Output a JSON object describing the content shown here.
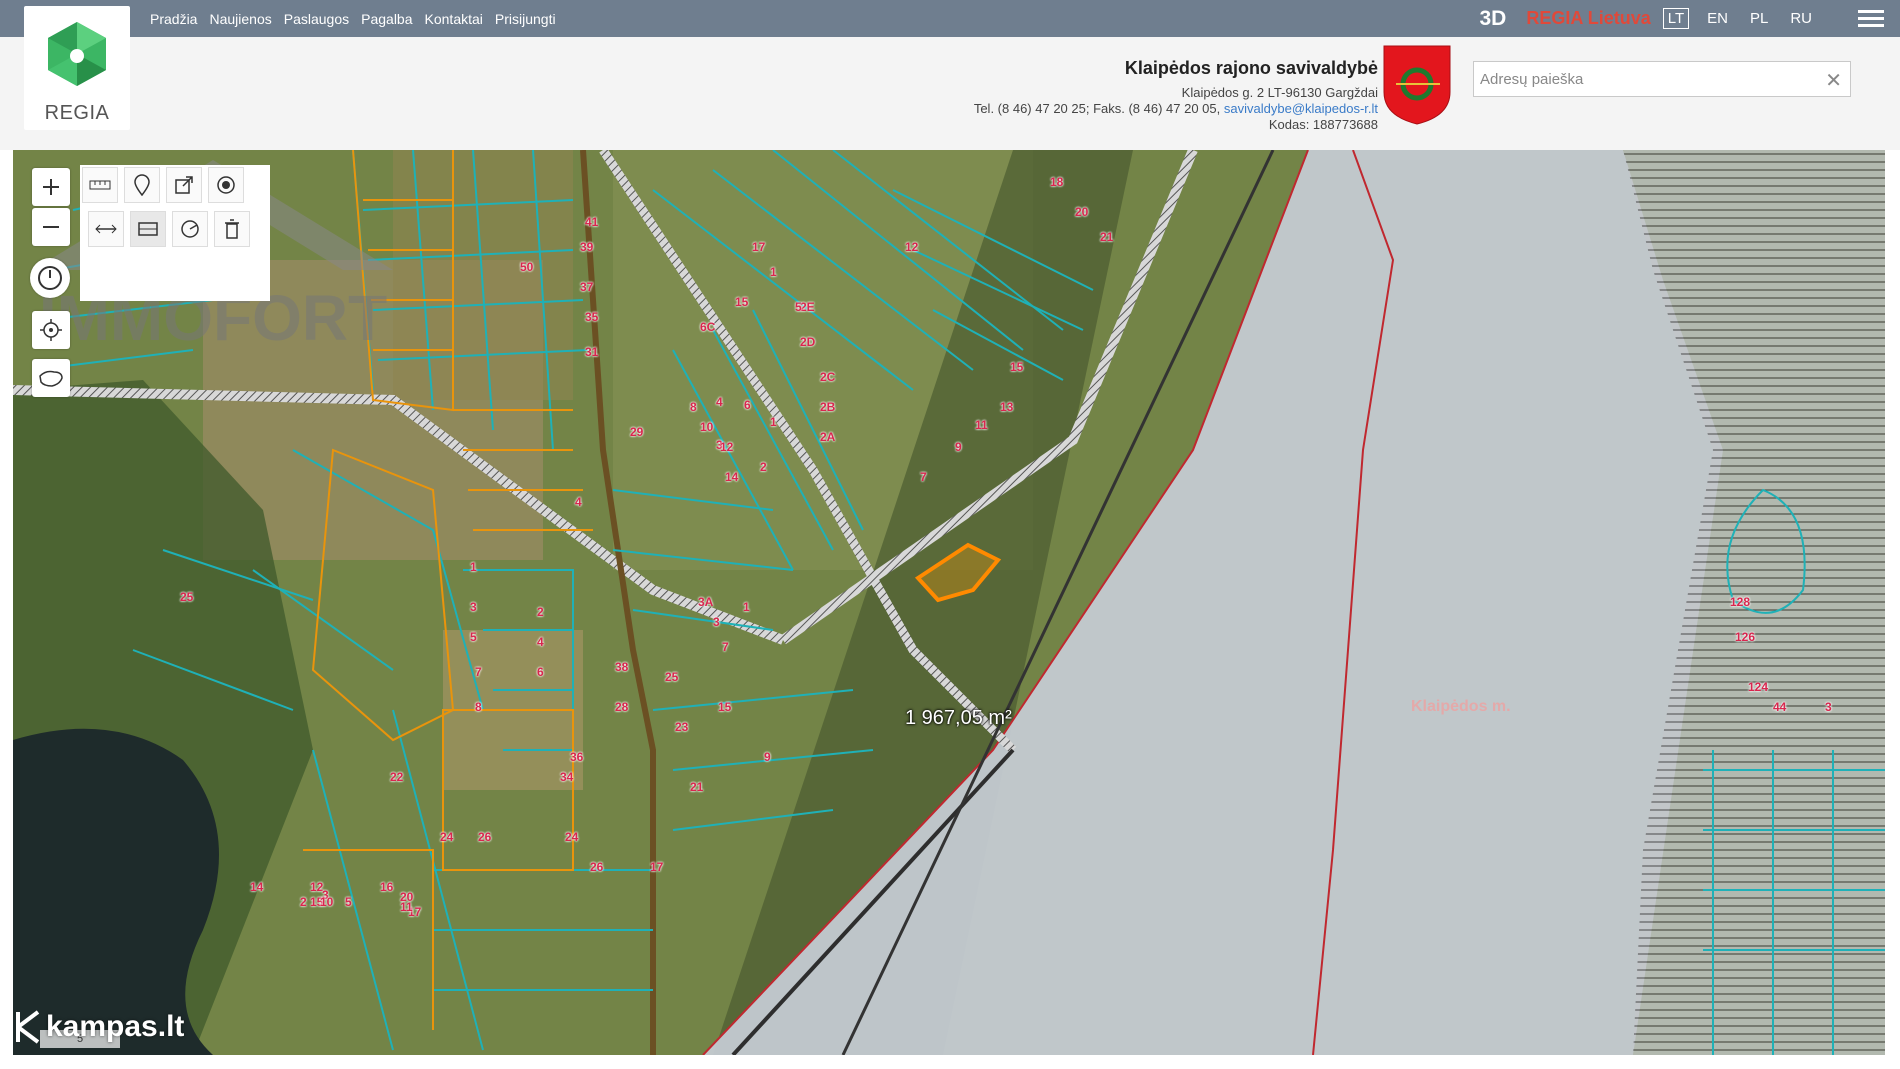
{
  "nav": {
    "items": [
      "Pradžia",
      "Naujienos",
      "Paslaugos",
      "Pagalba",
      "Kontaktai",
      "Prisijungti"
    ]
  },
  "logo": {
    "text": "REGIA"
  },
  "top_right": {
    "mode_3d": "3D",
    "brand": "REGIA Lietuva",
    "languages": [
      "LT",
      "EN",
      "PL",
      "RU"
    ],
    "active_language": "LT"
  },
  "municipality": {
    "name": "Klaipėdos rajono savivaldybė",
    "address": "Klaipėdos g. 2 LT-96130 Gargždai",
    "phone": "Tel. (8 46) 47 20 25; Faks. (8 46) 47 20 05,",
    "email": "savivaldybe@klaipedos-r.lt",
    "code": "Kodas: 188773688"
  },
  "search": {
    "placeholder": "Adresų paieška",
    "clear": "✕"
  },
  "map": {
    "measurement": "1 967,05 m²",
    "place_name": "Klaipėdos m.",
    "scale_text": "5",
    "colors": {
      "parcel": "#1fb1b7",
      "orange": "#e9940c",
      "red_boundary": "#c0282f",
      "road": "#5b5f63",
      "city_overlay": "#c7cdd6"
    },
    "parcel_labels": [
      "18",
      "20",
      "21",
      "12",
      "13",
      "15",
      "11",
      "9",
      "7",
      "17",
      "1",
      "2E",
      "2D",
      "2C",
      "2B",
      "2A",
      "2",
      "1",
      "15",
      "5",
      "6",
      "4",
      "3",
      "14",
      "12",
      "10",
      "8",
      "6C",
      "29",
      "37",
      "39",
      "35",
      "31",
      "41",
      "50",
      "4",
      "1",
      "3",
      "5",
      "7",
      "2",
      "4",
      "6",
      "8",
      "38",
      "28",
      "25",
      "23",
      "21",
      "17",
      "15",
      "9",
      "7",
      "3A",
      "3",
      "1",
      "36",
      "34",
      "24",
      "26",
      "22",
      "24",
      "26",
      "20",
      "17",
      "16",
      "11",
      "12",
      "15",
      "14",
      "2",
      "3",
      "5",
      "10",
      "25",
      "128",
      "126",
      "124",
      "44",
      "3"
    ]
  },
  "watermarks": {
    "kampas": "kampas.lt",
    "immofort": "IMMOFORT"
  }
}
